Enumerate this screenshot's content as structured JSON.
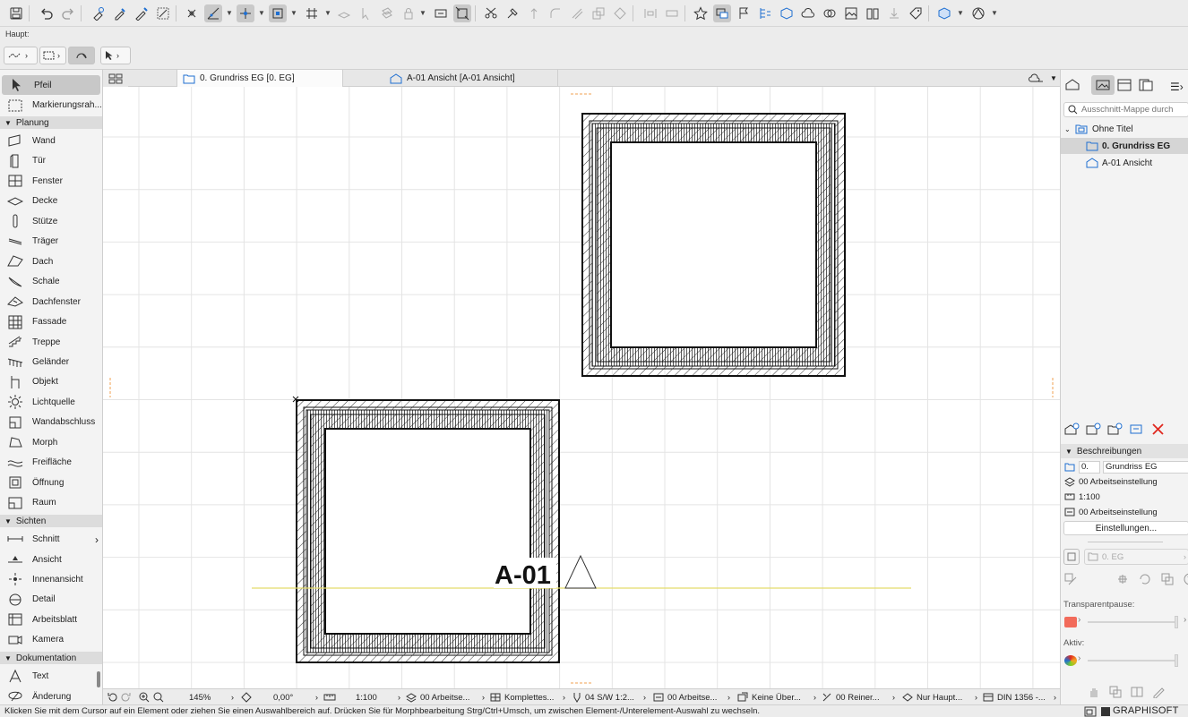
{
  "infobar": {
    "label": "Haupt:"
  },
  "tabs": [
    {
      "label": "0. Grundriss EG [0. EG]",
      "active": true
    },
    {
      "label": "A-01 Ansicht [A-01 Ansicht]",
      "active": false
    }
  ],
  "toolbox": {
    "items_top": [
      {
        "label": "Pfeil",
        "icon": "arrow-pointer-icon",
        "selected": true
      },
      {
        "label": "Markierungsrah...",
        "icon": "marquee-icon"
      }
    ],
    "sections": [
      {
        "label": "Planung",
        "items": [
          "Wand",
          "Tür",
          "Fenster",
          "Decke",
          "Stütze",
          "Träger",
          "Dach",
          "Schale",
          "Dachfenster",
          "Fassade",
          "Treppe",
          "Geländer",
          "Objekt",
          "Lichtquelle",
          "Wandabschluss",
          "Morph",
          "Freifläche",
          "Öffnung",
          "Raum"
        ]
      },
      {
        "label": "Sichten",
        "items": [
          "Schnitt",
          "Ansicht",
          "Innenansicht",
          "Detail",
          "Arbeitsblatt",
          "Kamera"
        ]
      },
      {
        "label": "Dokumentation",
        "items": [
          "Text",
          "Änderung"
        ]
      }
    ]
  },
  "canvas": {
    "elevation_marker": "A-01"
  },
  "ctrlbar": {
    "zoom": "145%",
    "angle": "0,00°",
    "scale": "1:100",
    "layer_combo": "00 Arbeitse...",
    "model_view": "Komplettes...",
    "pen_set": "04 S/W 1:2...",
    "overrides_combo": "00 Arbeitse...",
    "graphic_override": "Keine Über...",
    "renovation": "00 Reiner...",
    "structure": "Nur Haupt...",
    "paper": "DIN 1356 -..."
  },
  "statusbar": {
    "message": "Klicken Sie mit dem Cursor auf ein Element oder ziehen Sie einen Auswahlbereich auf. Drücken Sie für Morphbearbeitung Strg/Ctrl+Umsch, um zwischen Element-/Unterelement-Auswahl zu wechseln.",
    "brand": "GRAPHISOFT ID"
  },
  "navigator": {
    "search_placeholder": "Ausschnitt-Mappe durch",
    "tree": [
      {
        "label": "Ohne Titel",
        "level": 0
      },
      {
        "label": "0. Grundriss EG",
        "level": 1,
        "selected": true
      },
      {
        "label": "A-01 Ansicht",
        "level": 1
      }
    ],
    "descriptions_title": "Beschreibungen",
    "id_value": "0.",
    "name_value": "Grundriss EG",
    "layer_value": "00 Arbeitseinstellung",
    "scale_value": "1:100",
    "pen_value": "00 Arbeitseinstellung",
    "settings_button": "Einstellungen...",
    "story_value": "0. EG",
    "transparency_label": "Transparentpause:",
    "active_label": "Aktiv:"
  },
  "colors": {
    "accent": "#1f6fd1",
    "delete": "#e0281e",
    "elevation_line": "#e4dc6a",
    "grid": "#e4e4e4"
  }
}
